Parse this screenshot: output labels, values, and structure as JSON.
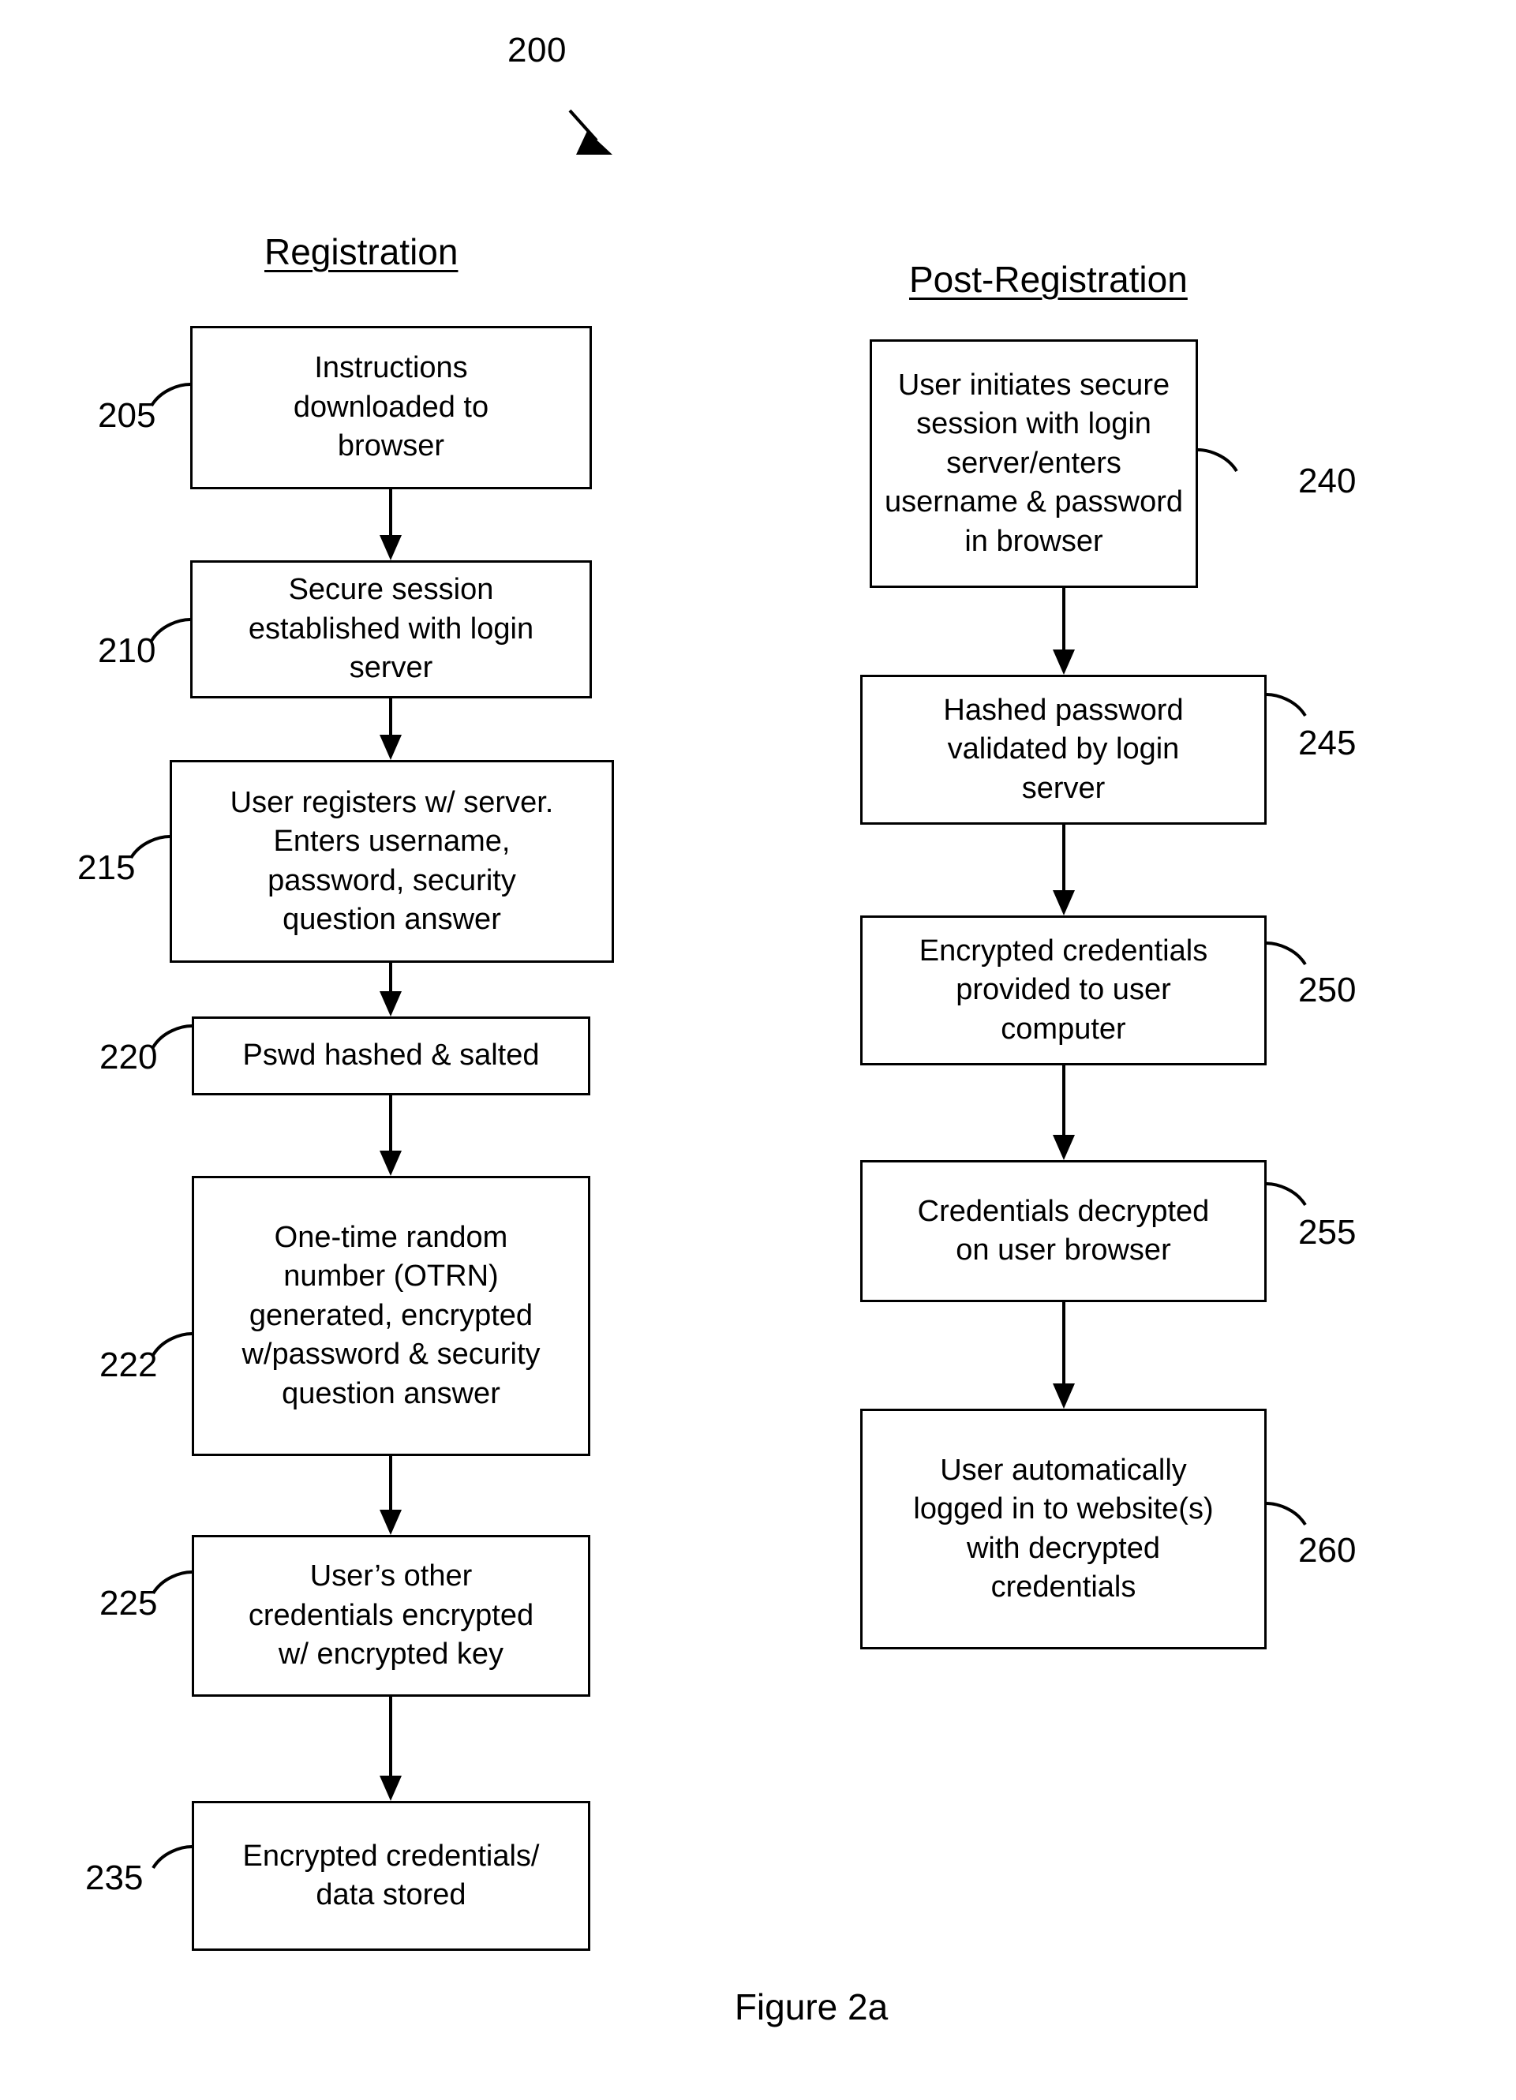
{
  "figure": {
    "number_label": "200",
    "caption": "Figure 2a"
  },
  "columns": [
    {
      "id": "registration",
      "heading": "Registration",
      "steps": [
        {
          "ref": "205",
          "text": "Instructions\ndownloaded to\nbrowser"
        },
        {
          "ref": "210",
          "text": "Secure session\nestablished with login\nserver"
        },
        {
          "ref": "215",
          "text": "User registers w/ server.\nEnters username,\npassword, security\nquestion answer"
        },
        {
          "ref": "220",
          "text": "Pswd hashed & salted"
        },
        {
          "ref": "222",
          "text": "One-time random\nnumber (OTRN)\ngenerated, encrypted\nw/password & security\nquestion answer"
        },
        {
          "ref": "225",
          "text": "User’s other\ncredentials encrypted\nw/ encrypted key"
        },
        {
          "ref": "235",
          "text": "Encrypted credentials/\ndata stored"
        }
      ]
    },
    {
      "id": "post-registration",
      "heading": "Post-Registration",
      "steps": [
        {
          "ref": "240",
          "text": "User initiates secure\nsession with login\nserver/enters\nusername & password\nin browser"
        },
        {
          "ref": "245",
          "text": "Hashed password\nvalidated by login\nserver"
        },
        {
          "ref": "250",
          "text": "Encrypted credentials\nprovided to user\ncomputer"
        },
        {
          "ref": "255",
          "text": "Credentials decrypted\non user browser"
        },
        {
          "ref": "260",
          "text": "User automatically\nlogged in to website(s)\nwith decrypted\ncredentials"
        }
      ]
    }
  ],
  "colors": {
    "ink": "#000000",
    "paper": "#ffffff"
  }
}
